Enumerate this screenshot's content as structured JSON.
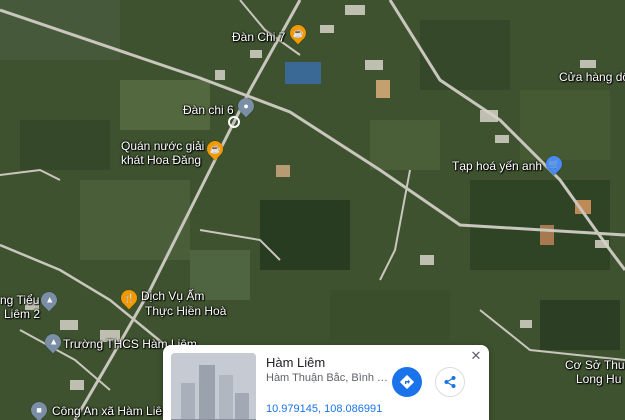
{
  "map": {
    "labels": {
      "dan_chi_7": "Đàn Chi 7",
      "dan_chi_6": "Đàn chi 6",
      "quan_nuoc_line1": "Quán nước giải",
      "quan_nuoc_line2": "khát Hoa Đăng",
      "cua_hang": "Cửa hàng dô",
      "tap_hoa": "Tạp hoá yến anh",
      "dich_vu_line1": "Dịch Vụ Ấm",
      "dich_vu_line2": "Thực Hiền Hoà",
      "ng_tieu_line1": "ng Tiểu",
      "ng_tieu_line2": "Liêm 2",
      "truong_thcs": "Trường THCS Hàm Liêm",
      "cong_an": "Công An xã Hàm Liê",
      "co_so_line1": "Cơ Sở Thu",
      "co_so_line2": "Long Hu"
    },
    "colors": {
      "restaurant_pin": "#f29900",
      "shop_pin": "#4a8af4",
      "school_pin": "#7a8fa6"
    },
    "icons": {
      "restaurant": "cup-icon",
      "shop": "cart-icon",
      "school": "school-icon",
      "food": "fork-knife-icon"
    }
  },
  "place_card": {
    "title": "Hàm Liêm",
    "subtitle": "Hàm Thuận Bắc, Bình T...",
    "coords": "10.979145, 108.086991",
    "close_glyph": "✕"
  }
}
